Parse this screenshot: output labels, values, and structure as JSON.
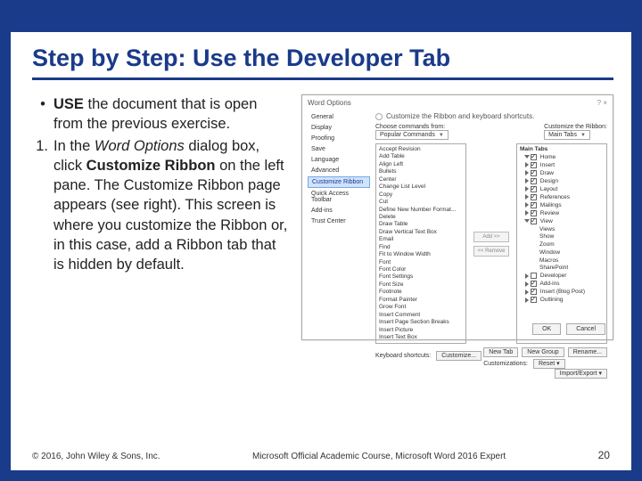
{
  "title": "Step by Step: Use the Developer Tab",
  "bullet": {
    "marker": "•",
    "bold": "USE",
    "rest": " the document that is open from the previous exercise."
  },
  "step": {
    "num": "1.",
    "pre": "In the ",
    "italic": "Word Options",
    "mid1": " dialog box, click ",
    "bold": "Customize Ribbon",
    "mid2": " on the left pane. The Customize Ribbon page appears (see right). This screen is where you customize the Ribbon or, in this case, add a Ribbon tab that is hidden by default."
  },
  "dialog": {
    "title": "Word Options",
    "winctrls": "?    ×",
    "nav": [
      "General",
      "Display",
      "Proofing",
      "Save",
      "Language",
      "Advanced",
      "Customize Ribbon",
      "Quick Access Toolbar",
      "Add-ins",
      "Trust Center"
    ],
    "heading": "Customize the Ribbon and keyboard shortcuts.",
    "chooseLabel": "Choose commands from:",
    "chooseValue": "Popular Commands",
    "custLabel": "Customize the Ribbon:",
    "custValue": "Main Tabs",
    "left": [
      "Accept Revision",
      "Add Table",
      "Align Left",
      "Bullets",
      "Center",
      "Change List Level",
      "Copy",
      "Cut",
      "Define New Number Format...",
      "Delete",
      "Draw Table",
      "Draw Vertical Text Box",
      "Email",
      "Find",
      "Fit to Window Width",
      "Font",
      "Font Color",
      "Font Settings",
      "Font Size",
      "Footnote",
      "Format Painter",
      "Grow Font",
      "Insert Comment",
      "Insert Page Section Breaks",
      "Insert Picture",
      "Insert Text Box"
    ],
    "addBtn": "Add >>",
    "removeBtn": "<< Remove",
    "tree": [
      {
        "label": "Main Tabs",
        "type": "head"
      },
      {
        "label": "Home",
        "ck": true,
        "open": true
      },
      {
        "label": "Insert",
        "ck": true
      },
      {
        "label": "Draw",
        "ck": true
      },
      {
        "label": "Design",
        "ck": true
      },
      {
        "label": "Layout",
        "ck": true
      },
      {
        "label": "References",
        "ck": true
      },
      {
        "label": "Mailings",
        "ck": true
      },
      {
        "label": "Review",
        "ck": true
      },
      {
        "label": "View",
        "ck": true,
        "open": true
      },
      {
        "label": "Views",
        "sub": true
      },
      {
        "label": "Show",
        "sub": true
      },
      {
        "label": "Zoom",
        "sub": true
      },
      {
        "label": "Window",
        "sub": true
      },
      {
        "label": "Macros",
        "sub": true
      },
      {
        "label": "SharePoint",
        "sub": true
      },
      {
        "label": "Developer",
        "ck": false
      },
      {
        "label": "Add-ins",
        "ck": true
      },
      {
        "label": "Insert (Blog Post)",
        "ck": true
      },
      {
        "label": "Outlining",
        "ck": true
      }
    ],
    "belowBtns": [
      "New Tab",
      "New Group",
      "Rename..."
    ],
    "custRow": "Customizations:",
    "resetBtn": "Reset ▾",
    "ieBtn": "Import/Export ▾",
    "kbLabel": "Keyboard shortcuts:",
    "kbBtn": "Customize...",
    "ok": "OK",
    "cancel": "Cancel"
  },
  "footer": {
    "copyright": "© 2016, John Wiley & Sons, Inc.",
    "course": "Microsoft Official Academic Course, Microsoft Word 2016 Expert",
    "page": "20"
  }
}
